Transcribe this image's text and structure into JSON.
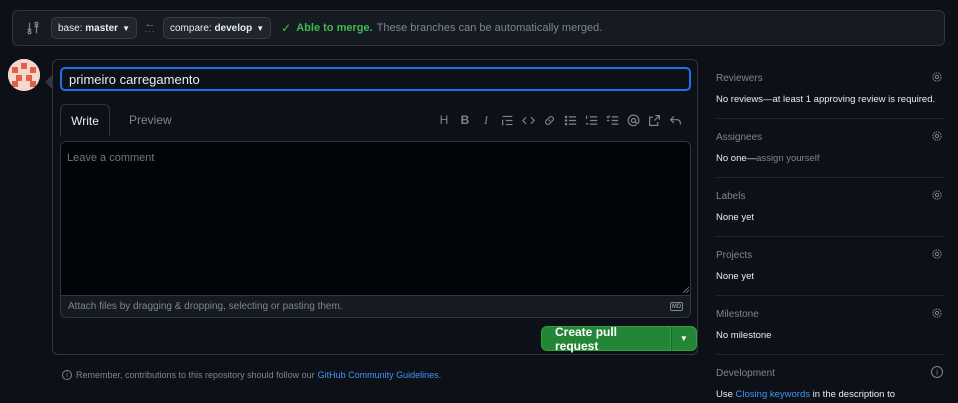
{
  "compare": {
    "base_key": "base:",
    "base_value": "master",
    "compare_key": "compare:",
    "compare_value": "develop",
    "status": "Able to merge.",
    "status_desc": "These branches can be automatically merged."
  },
  "form": {
    "title_value": "primeiro carregamento",
    "tabs": [
      "Write",
      "Preview"
    ],
    "toolbar": [
      "H",
      "B",
      "I"
    ],
    "comment_placeholder": "Leave a comment",
    "attach_text": "Attach files by dragging & dropping, selecting or pasting them.",
    "markdown_badge": "MD",
    "create_label": "Create pull request"
  },
  "footer": {
    "info_glyph": "i",
    "text": "Remember, contributions to this repository should follow our",
    "link": "GitHub Community Guidelines",
    "end": "."
  },
  "sidebar": {
    "reviewers": {
      "title": "Reviewers",
      "value": "No reviews—at least 1 approving review is required."
    },
    "assignees": {
      "title": "Assignees",
      "value_bold": "No one—",
      "value_dim": "assign yourself"
    },
    "labels": {
      "title": "Labels",
      "value": "None yet"
    },
    "projects": {
      "title": "Projects",
      "value": "None yet"
    },
    "milestone": {
      "title": "Milestone",
      "value": "No milestone"
    },
    "development": {
      "title": "Development",
      "info_glyph": "i",
      "pre": "Use",
      "link": "Closing keywords",
      "post": "in the description to"
    }
  },
  "colors": {
    "accent_blue": "#1f6feb",
    "success_green": "#238636",
    "link_blue": "#4493f8"
  }
}
